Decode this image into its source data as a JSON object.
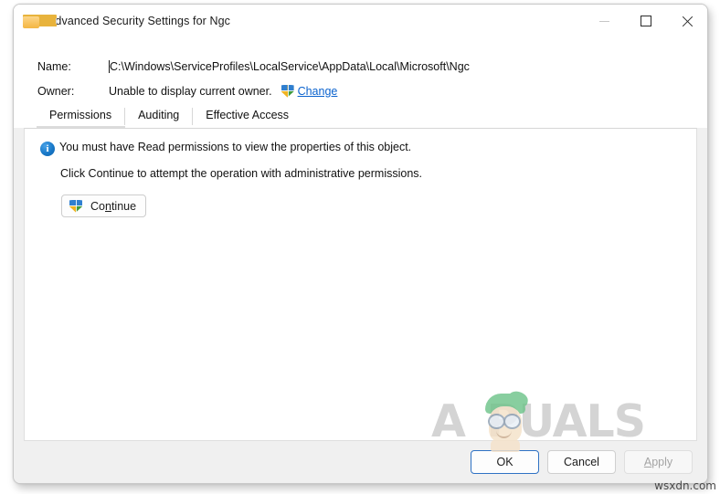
{
  "window": {
    "title": "Advanced Security Settings for Ngc",
    "icon": "folder-icon",
    "controls": {
      "minimize": "—",
      "maximize": "□",
      "close": "✕",
      "minimize_disabled": true
    }
  },
  "header": {
    "name_label": "Name:",
    "name_value": "C:\\Windows\\ServiceProfiles\\LocalService\\AppData\\Local\\Microsoft\\Ngc",
    "owner_label": "Owner:",
    "owner_value": "Unable to display current owner.",
    "change_link": "Change"
  },
  "tabs": [
    {
      "label": "Permissions",
      "active": true
    },
    {
      "label": "Auditing",
      "active": false
    },
    {
      "label": "Effective Access",
      "active": false
    }
  ],
  "content": {
    "message_primary": "You must have Read permissions to view the properties of this object.",
    "message_secondary": "Click Continue to attempt the operation with administrative permissions.",
    "continue_button": {
      "prefix": "Co",
      "accelerator": "n",
      "suffix": "tinue"
    }
  },
  "footer": {
    "ok": "OK",
    "cancel": "Cancel",
    "apply": {
      "accelerator": "A",
      "suffix": "pply",
      "disabled": true
    }
  },
  "watermark": {
    "text_before": "A",
    "text_after": "PUALS",
    "source": "wsxdn.com"
  },
  "colors": {
    "accent": "#2f72c4",
    "link": "#0b63ce",
    "info_icon": "#1878c8",
    "folder": "#f3b744",
    "dialog_bg": "#f0f0f0",
    "panel_bg": "#ffffff"
  }
}
